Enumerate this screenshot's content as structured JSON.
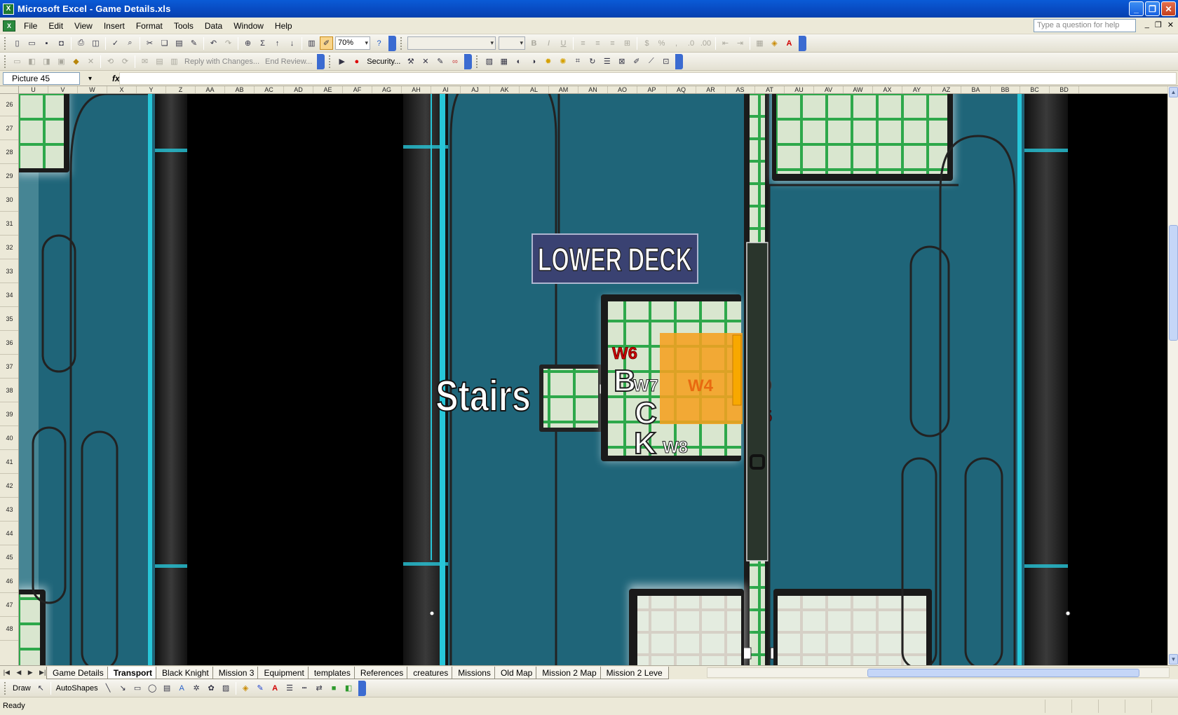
{
  "window": {
    "title": "Microsoft Excel - Game Details.xls",
    "controls": {
      "minimize": "_",
      "restore": "❐",
      "close": "✕"
    }
  },
  "menu": {
    "items": [
      "File",
      "Edit",
      "View",
      "Insert",
      "Format",
      "Tools",
      "Data",
      "Window",
      "Help"
    ],
    "help_placeholder": "Type a question for help"
  },
  "toolbar": {
    "zoom": "70%",
    "reply_with_changes": "Reply with Changes...",
    "end_review": "End Review...",
    "security": "Security..."
  },
  "formula_bar": {
    "name_box": "Picture 45",
    "fx": "fx",
    "formula": ""
  },
  "columns": [
    "U",
    "V",
    "W",
    "X",
    "Y",
    "Z",
    "AA",
    "AB",
    "AC",
    "AD",
    "AE",
    "AF",
    "AG",
    "AH",
    "AI",
    "AJ",
    "AK",
    "AL",
    "AM",
    "AN",
    "AO",
    "AP",
    "AQ",
    "AR",
    "AS",
    "AT",
    "AU",
    "AV",
    "AW",
    "AX",
    "AY",
    "AZ",
    "BA",
    "BB",
    "BC",
    "BD"
  ],
  "rows": [
    "26",
    "27",
    "28",
    "29",
    "30",
    "31",
    "32",
    "33",
    "34",
    "35",
    "36",
    "37",
    "38",
    "39",
    "40",
    "41",
    "42",
    "43",
    "44",
    "45",
    "46",
    "47",
    "48"
  ],
  "map": {
    "deck_label": "LOWER DECK",
    "stairs_label": "Stairs",
    "room_letters": [
      "B",
      "C",
      "K"
    ],
    "waypoints": [
      "W6",
      "W7",
      "W4",
      "W9",
      "W5",
      "W8"
    ],
    "colors": {
      "water": "#1f6579",
      "wall": "#1a1a1a",
      "floor_tile": "#d8e5cc",
      "tile_grid": "#2ea84b",
      "highlight": "#f5a020",
      "cyan_line": "#27c6d8",
      "label_bg": "#3a4272"
    }
  },
  "sheet_tabs": [
    "Game Details",
    "Transport",
    "Black Knight",
    "Mission 3",
    "Equipment",
    "templates",
    "References",
    "creatures",
    "Missions",
    "Old Map",
    "Mission 2 Map",
    "Mission 2 Leve"
  ],
  "active_tab": "Transport",
  "drawing_toolbar": {
    "draw": "Draw",
    "autoshapes": "AutoShapes"
  },
  "status": "Ready"
}
